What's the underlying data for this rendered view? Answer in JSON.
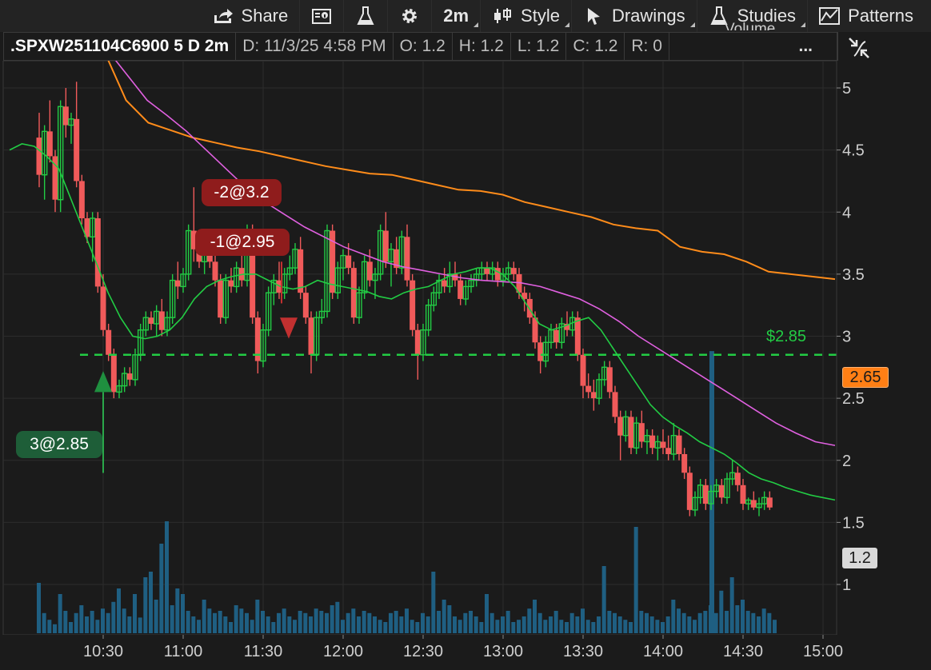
{
  "toolbar": {
    "share": "Share",
    "timeframe": "2m",
    "style": "Style",
    "drawings": "Drawings",
    "studies": "Studies",
    "patterns": "Patterns",
    "icons": [
      "share-icon",
      "notes-icon",
      "flask-icon",
      "gear-icon",
      "candlestick-icon",
      "cursor-icon",
      "studies-flask-icon",
      "patterns-icon"
    ]
  },
  "infobar": {
    "symbol": ".SPXW251104C6900 5 D 2m",
    "date": "D: 11/3/25 4:58 PM",
    "open": "O: 1.2",
    "high": "H: 1.2",
    "low": "L: 1.2",
    "close": "C: 1.2",
    "range": "R: 0",
    "more": "...",
    "volume_label": "Volume"
  },
  "price_axis": {
    "current_price": "2.65",
    "current_volume": "1.2"
  },
  "orders": {
    "buy": "3@2.85",
    "sell1": "-2@3.2",
    "sell2": "-1@2.95",
    "stop_line": "$2.85"
  },
  "colors": {
    "up": "#22cc44",
    "down": "#f05a5a",
    "ema": "#22cc44",
    "vwap": "#e060e0",
    "slow_ma": "#ff8c1a",
    "volume": "#1f5f82",
    "stop": "#22cc44",
    "price_tag": "#ff7f15"
  },
  "chart_data": {
    "type": "candlestick",
    "x_ticks": [
      "10:30",
      "11:00",
      "11:30",
      "12:00",
      "12:30",
      "13:00",
      "13:30",
      "14:00",
      "14:30",
      "15:00"
    ],
    "y_ticks": [
      "5",
      "4.5",
      "4",
      "3.5",
      "3",
      "2.5",
      "2",
      "1.5",
      "1"
    ],
    "ylim": [
      0.75,
      5.3
    ],
    "start_time": "10:06",
    "bar_minutes": 2,
    "candles": [
      [
        4.6,
        4.8,
        4.2,
        4.3
      ],
      [
        4.3,
        4.7,
        4.1,
        4.65
      ],
      [
        4.65,
        4.9,
        4.4,
        4.45
      ],
      [
        4.45,
        4.5,
        4.0,
        4.1
      ],
      [
        4.1,
        4.9,
        4.0,
        4.85
      ],
      [
        4.85,
        5.0,
        4.6,
        4.7
      ],
      [
        4.7,
        4.8,
        4.55,
        4.75
      ],
      [
        4.75,
        5.05,
        4.2,
        4.25
      ],
      [
        4.25,
        4.3,
        3.9,
        3.95
      ],
      [
        3.95,
        4.0,
        3.75,
        3.8
      ],
      [
        3.8,
        4.0,
        3.6,
        3.95
      ],
      [
        3.95,
        4.0,
        3.35,
        3.4
      ],
      [
        3.4,
        3.5,
        3.0,
        3.05
      ],
      [
        3.05,
        3.1,
        2.8,
        2.85
      ],
      [
        2.85,
        2.9,
        2.5,
        2.55
      ],
      [
        2.55,
        2.65,
        2.5,
        2.6
      ],
      [
        2.6,
        2.75,
        2.55,
        2.7
      ],
      [
        2.7,
        2.75,
        2.6,
        2.65
      ],
      [
        2.65,
        2.9,
        2.6,
        2.85
      ],
      [
        2.85,
        3.1,
        2.8,
        3.05
      ],
      [
        3.05,
        3.2,
        3.0,
        3.15
      ],
      [
        3.15,
        3.2,
        3.05,
        3.1
      ],
      [
        3.1,
        3.25,
        3.0,
        3.2
      ],
      [
        3.2,
        3.3,
        3.0,
        3.05
      ],
      [
        3.05,
        3.2,
        3.0,
        3.15
      ],
      [
        3.15,
        3.5,
        3.1,
        3.45
      ],
      [
        3.45,
        3.6,
        3.3,
        3.4
      ],
      [
        3.4,
        3.55,
        3.35,
        3.5
      ],
      [
        3.5,
        3.9,
        3.45,
        3.85
      ],
      [
        3.85,
        4.2,
        3.6,
        3.7
      ],
      [
        3.7,
        3.85,
        3.55,
        3.6
      ],
      [
        3.6,
        3.75,
        3.5,
        3.7
      ],
      [
        3.7,
        3.8,
        3.55,
        3.6
      ],
      [
        3.6,
        3.65,
        3.4,
        3.45
      ],
      [
        3.45,
        3.5,
        3.1,
        3.15
      ],
      [
        3.15,
        3.5,
        3.1,
        3.45
      ],
      [
        3.45,
        3.55,
        3.35,
        3.4
      ],
      [
        3.4,
        3.6,
        3.35,
        3.55
      ],
      [
        3.55,
        3.65,
        3.4,
        3.45
      ],
      [
        3.45,
        3.9,
        3.4,
        3.85
      ],
      [
        3.85,
        3.9,
        3.1,
        3.15
      ],
      [
        3.15,
        3.2,
        2.7,
        2.8
      ],
      [
        2.8,
        3.1,
        2.75,
        3.05
      ],
      [
        3.05,
        3.4,
        3.0,
        3.35
      ],
      [
        3.35,
        3.5,
        3.25,
        3.45
      ],
      [
        3.45,
        3.6,
        3.3,
        3.35
      ],
      [
        3.35,
        3.55,
        3.3,
        3.5
      ],
      [
        3.5,
        3.65,
        3.45,
        3.55
      ],
      [
        3.55,
        3.75,
        3.5,
        3.7
      ],
      [
        3.7,
        3.8,
        3.3,
        3.35
      ],
      [
        3.35,
        3.4,
        3.1,
        3.15
      ],
      [
        3.15,
        3.2,
        2.7,
        2.85
      ],
      [
        2.85,
        3.2,
        2.8,
        3.15
      ],
      [
        3.15,
        3.3,
        3.1,
        3.2
      ],
      [
        3.2,
        3.9,
        3.15,
        3.85
      ],
      [
        3.85,
        3.9,
        3.3,
        3.35
      ],
      [
        3.35,
        3.6,
        3.3,
        3.55
      ],
      [
        3.55,
        3.7,
        3.45,
        3.65
      ],
      [
        3.65,
        3.75,
        3.5,
        3.55
      ],
      [
        3.55,
        3.6,
        3.1,
        3.15
      ],
      [
        3.15,
        3.4,
        3.1,
        3.35
      ],
      [
        3.35,
        3.65,
        3.3,
        3.6
      ],
      [
        3.6,
        3.7,
        3.4,
        3.45
      ],
      [
        3.45,
        3.55,
        3.3,
        3.5
      ],
      [
        3.5,
        3.9,
        3.45,
        3.85
      ],
      [
        3.85,
        4.0,
        3.55,
        3.6
      ],
      [
        3.6,
        3.75,
        3.4,
        3.7
      ],
      [
        3.7,
        3.8,
        3.5,
        3.55
      ],
      [
        3.55,
        3.85,
        3.5,
        3.8
      ],
      [
        3.8,
        3.9,
        3.4,
        3.45
      ],
      [
        3.45,
        3.5,
        3.0,
        3.05
      ],
      [
        3.05,
        3.1,
        2.65,
        2.85
      ],
      [
        2.85,
        3.1,
        2.8,
        3.05
      ],
      [
        3.05,
        3.3,
        3.0,
        3.25
      ],
      [
        3.25,
        3.4,
        3.2,
        3.35
      ],
      [
        3.35,
        3.5,
        3.3,
        3.45
      ],
      [
        3.45,
        3.55,
        3.35,
        3.4
      ],
      [
        3.4,
        3.6,
        3.35,
        3.5
      ],
      [
        3.5,
        3.6,
        3.4,
        3.45
      ],
      [
        3.45,
        3.5,
        3.25,
        3.3
      ],
      [
        3.3,
        3.45,
        3.25,
        3.4
      ],
      [
        3.4,
        3.5,
        3.35,
        3.45
      ],
      [
        3.45,
        3.55,
        3.4,
        3.5
      ],
      [
        3.5,
        3.6,
        3.45,
        3.55
      ],
      [
        3.55,
        3.6,
        3.45,
        3.5
      ],
      [
        3.5,
        3.6,
        3.45,
        3.55
      ],
      [
        3.55,
        3.6,
        3.4,
        3.45
      ],
      [
        3.45,
        3.55,
        3.4,
        3.5
      ],
      [
        3.5,
        3.6,
        3.45,
        3.55
      ],
      [
        3.55,
        3.6,
        3.45,
        3.5
      ],
      [
        3.5,
        3.55,
        3.3,
        3.35
      ],
      [
        3.35,
        3.4,
        3.2,
        3.3
      ],
      [
        3.3,
        3.35,
        3.1,
        3.15
      ],
      [
        3.15,
        3.2,
        2.9,
        2.95
      ],
      [
        2.95,
        3.0,
        2.7,
        2.8
      ],
      [
        2.8,
        3.0,
        2.75,
        2.95
      ],
      [
        2.95,
        3.1,
        2.9,
        3.05
      ],
      [
        3.05,
        3.1,
        2.9,
        2.95
      ],
      [
        2.95,
        3.15,
        2.9,
        3.1
      ],
      [
        3.1,
        3.2,
        3.0,
        3.05
      ],
      [
        3.05,
        3.2,
        3.0,
        3.15
      ],
      [
        3.15,
        3.2,
        2.8,
        2.85
      ],
      [
        2.85,
        2.9,
        2.5,
        2.6
      ],
      [
        2.6,
        2.7,
        2.5,
        2.55
      ],
      [
        2.55,
        2.65,
        2.4,
        2.5
      ],
      [
        2.5,
        2.7,
        2.45,
        2.65
      ],
      [
        2.65,
        2.8,
        2.6,
        2.75
      ],
      [
        2.75,
        2.8,
        2.5,
        2.55
      ],
      [
        2.55,
        2.6,
        2.3,
        2.35
      ],
      [
        2.35,
        2.4,
        2.0,
        2.2
      ],
      [
        2.2,
        2.4,
        2.15,
        2.35
      ],
      [
        2.35,
        2.4,
        2.05,
        2.1
      ],
      [
        2.1,
        2.35,
        2.05,
        2.3
      ],
      [
        2.3,
        2.4,
        2.1,
        2.15
      ],
      [
        2.15,
        2.25,
        2.05,
        2.2
      ],
      [
        2.2,
        2.25,
        2.05,
        2.1
      ],
      [
        2.1,
        2.2,
        2.0,
        2.15
      ],
      [
        2.15,
        2.25,
        2.05,
        2.1
      ],
      [
        2.1,
        2.2,
        2.0,
        2.05
      ],
      [
        2.05,
        2.3,
        2.0,
        2.2
      ],
      [
        2.2,
        2.25,
        2.0,
        2.05
      ],
      [
        2.05,
        2.1,
        1.85,
        1.9
      ],
      [
        1.9,
        1.95,
        1.55,
        1.6
      ],
      [
        1.6,
        1.75,
        1.55,
        1.7
      ],
      [
        1.7,
        1.85,
        1.65,
        1.8
      ],
      [
        1.8,
        1.85,
        1.6,
        1.65
      ],
      [
        1.65,
        1.8,
        1.6,
        1.75
      ],
      [
        1.75,
        1.85,
        1.7,
        1.8
      ],
      [
        1.8,
        1.85,
        1.65,
        1.7
      ],
      [
        1.7,
        1.9,
        1.65,
        1.85
      ],
      [
        1.85,
        2.0,
        1.8,
        1.9
      ],
      [
        1.9,
        1.95,
        1.75,
        1.8
      ],
      [
        1.8,
        1.85,
        1.6,
        1.65
      ],
      [
        1.65,
        1.7,
        1.6,
        1.68
      ],
      [
        1.68,
        1.75,
        1.6,
        1.62
      ],
      [
        1.62,
        1.7,
        1.55,
        1.65
      ],
      [
        1.65,
        1.75,
        1.6,
        1.7
      ],
      [
        1.7,
        1.75,
        1.6,
        1.62
      ]
    ],
    "ema": [
      4.5,
      4.55,
      4.53,
      4.45,
      4.35,
      4.1,
      3.85,
      3.6,
      3.35,
      3.15,
      3.0,
      2.98,
      3.0,
      3.05,
      3.15,
      3.3,
      3.4,
      3.45,
      3.48,
      3.5,
      3.5,
      3.45,
      3.4,
      3.38,
      3.4,
      3.45,
      3.42,
      3.4,
      3.38,
      3.36,
      3.32,
      3.3,
      3.35,
      3.38,
      3.4,
      3.45,
      3.5,
      3.52,
      3.55,
      3.55,
      3.5,
      3.4,
      3.25,
      3.1,
      3.05,
      3.08,
      3.12,
      3.15,
      3.05,
      2.9,
      2.75,
      2.6,
      2.45,
      2.35,
      2.28,
      2.22,
      2.15,
      2.1,
      2.05,
      1.98,
      1.9,
      1.85,
      1.82,
      1.78,
      1.75,
      1.72,
      1.7,
      1.68
    ],
    "vwap": [
      5.3,
      5.1,
      4.9,
      4.78,
      4.65,
      4.5,
      4.35,
      4.2,
      4.08,
      3.98,
      3.88,
      3.8,
      3.72,
      3.66,
      3.6,
      3.56,
      3.53,
      3.5,
      3.47,
      3.45,
      3.44,
      3.43,
      3.4,
      3.35,
      3.3,
      3.22,
      3.12,
      3.0,
      2.9,
      2.8,
      2.7,
      2.6,
      2.5,
      2.4,
      2.3,
      2.22,
      2.15,
      2.12
    ],
    "slow_ma": [
      5.3,
      4.9,
      4.72,
      4.66,
      4.6,
      4.56,
      4.52,
      4.49,
      4.45,
      4.41,
      4.37,
      4.34,
      4.31,
      4.3,
      4.26,
      4.22,
      4.18,
      4.17,
      4.14,
      4.08,
      4.04,
      4.0,
      3.96,
      3.9,
      3.87,
      3.85,
      3.72,
      3.68,
      3.66,
      3.6,
      3.52,
      3.5,
      3.48,
      3.46
    ],
    "volume": [
      0.45,
      0.18,
      0.12,
      0.08,
      0.35,
      0.2,
      0.1,
      0.18,
      0.25,
      0.15,
      0.2,
      0.12,
      0.22,
      0.18,
      0.28,
      0.4,
      0.22,
      0.15,
      0.35,
      0.14,
      0.5,
      0.55,
      0.3,
      0.8,
      1.0,
      0.25,
      0.4,
      0.35,
      0.2,
      0.15,
      0.12,
      0.3,
      0.22,
      0.18,
      0.2,
      0.15,
      0.1,
      0.25,
      0.22,
      0.18,
      0.12,
      0.3,
      0.2,
      0.15,
      0.1,
      0.18,
      0.22,
      0.15,
      0.12,
      0.2,
      0.18,
      0.15,
      0.22,
      0.2,
      0.18,
      0.25,
      0.28,
      0.12,
      0.18,
      0.22,
      0.15,
      0.2,
      0.18,
      0.15,
      0.12,
      0.1,
      0.18,
      0.2,
      0.15,
      0.22,
      0.12,
      0.1,
      0.18,
      0.15,
      0.55,
      0.2,
      0.3,
      0.25,
      0.15,
      0.12,
      0.18,
      0.2,
      0.15,
      0.1,
      0.35,
      0.18,
      0.12,
      0.15,
      0.2,
      0.1,
      0.12,
      0.15,
      0.22,
      0.3,
      0.18,
      0.12,
      0.15,
      0.2,
      0.12,
      0.1,
      0.18,
      0.15,
      0.22,
      0.12,
      0.1,
      0.15,
      0.6,
      0.2,
      0.18,
      0.15,
      0.12,
      0.1,
      0.95,
      0.2,
      0.18,
      0.15,
      0.12,
      0.1,
      0.15,
      0.3,
      0.22,
      0.18,
      0.15,
      0.12,
      0.18,
      0.2,
      0.25,
      0.18,
      0.38,
      0.2,
      0.5,
      0.25,
      0.3,
      0.2,
      0.18,
      0.15,
      0.22,
      0.18,
      0.12
    ]
  }
}
